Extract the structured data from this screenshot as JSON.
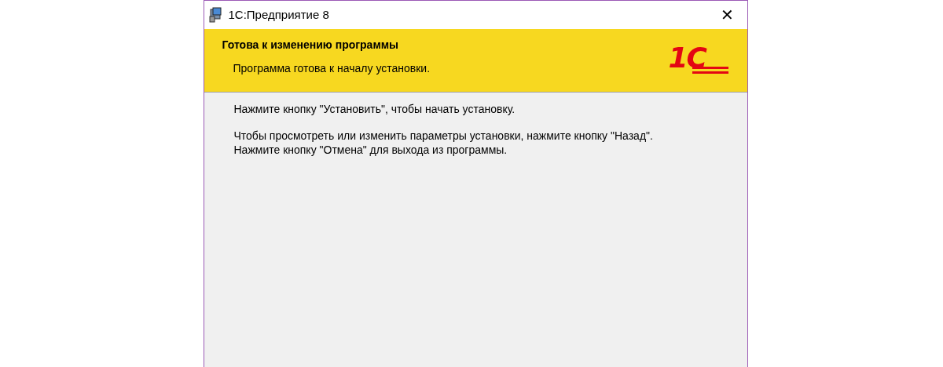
{
  "window": {
    "title": "1С:Предприятие 8",
    "close": "✕"
  },
  "header": {
    "title": "Готова к изменению программы",
    "subtitle": "Программа готова к началу установки.",
    "logo": "1С"
  },
  "paragraphs": [
    [
      "Нажмите кнопку \"Установить\", чтобы начать установку."
    ],
    [
      "Чтобы просмотреть или изменить параметры установки, нажмите кнопку \"Назад\".",
      "Нажмите кнопку \"Отмена\" для выхода из программы."
    ]
  ]
}
